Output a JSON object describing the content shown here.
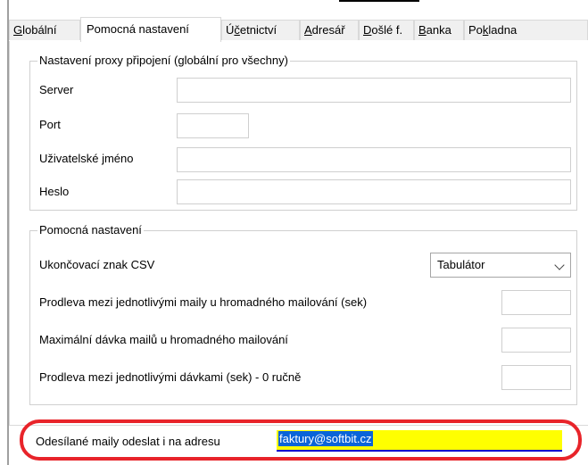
{
  "tabs": [
    {
      "id": "globalni",
      "label": "Globální",
      "accel_index": 0,
      "active": false
    },
    {
      "id": "pomocna",
      "label": "Pomocná nastavení",
      "accel_index": -1,
      "active": true
    },
    {
      "id": "ucetnictvi",
      "label": "Účetnictví",
      "accel_index": 1,
      "active": false
    },
    {
      "id": "adresar",
      "label": "Adresář",
      "accel_index": 0,
      "active": false
    },
    {
      "id": "dosle",
      "label": "Došlé f.",
      "accel_index": 0,
      "active": false
    },
    {
      "id": "banka",
      "label": "Banka",
      "accel_index": 0,
      "active": false
    },
    {
      "id": "pokladna",
      "label": "Pokladna",
      "accel_index": 2,
      "active": false
    }
  ],
  "proxy": {
    "title": "Nastavení proxy připojení (globální pro všechny)",
    "server_label": "Server",
    "server_value": "",
    "port_label": "Port",
    "port_value": "",
    "username_label": "Uživatelské jméno",
    "username_value": "",
    "password_label": "Heslo",
    "password_value": ""
  },
  "aux": {
    "title": "Pomocná nastavení",
    "csv_label": "Ukončovací znak CSV",
    "csv_value": "Tabulátor",
    "delay_mails_label": "Prodleva mezi jednotlivými maily u hromadného mailování (sek)",
    "delay_mails_value": "",
    "max_batch_label": "Maximální dávka mailů u hromadného mailování",
    "max_batch_value": "",
    "delay_batches_label": "Prodleva mezi jednotlivými dávkami (sek) - 0 ručně",
    "delay_batches_value": ""
  },
  "email": {
    "label": "Odesílané maily odeslat i na adresu",
    "value": "faktury@softbit.cz"
  },
  "colors": {
    "highlight_ring": "#e8242a",
    "field_highlight": "#ffff00",
    "selection": "#0a64d8"
  }
}
